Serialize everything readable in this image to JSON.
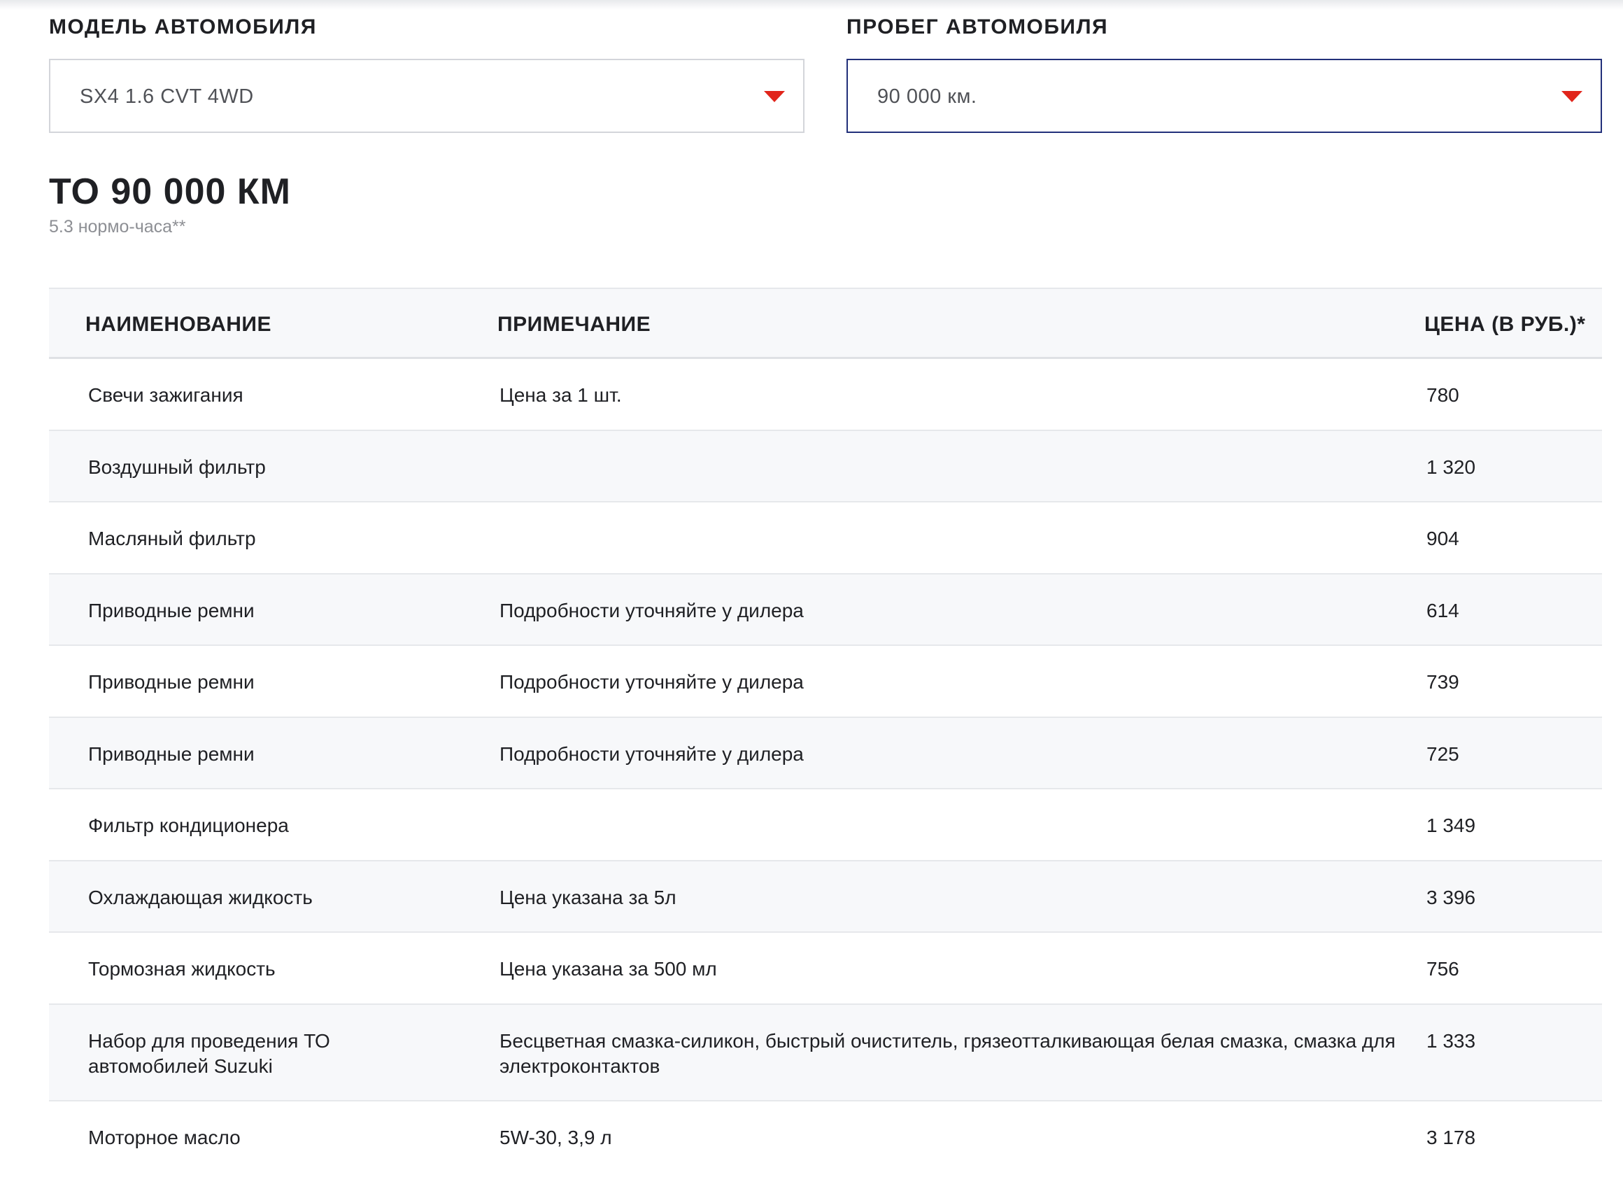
{
  "selectors": {
    "model": {
      "label": "МОДЕЛЬ АВТОМОБИЛЯ",
      "value": "SX4 1.6 CVT 4WD"
    },
    "mileage": {
      "label": "ПРОБЕГ АВТОМОБИЛЯ",
      "value": "90 000 км."
    }
  },
  "service": {
    "title": "ТО 90 000 КМ",
    "hours": "5.3 нормо-часа**"
  },
  "table": {
    "headers": {
      "name": "НАИМЕНОВАНИЕ",
      "note": "ПРИМЕЧАНИЕ",
      "price": "ЦЕНА (В РУБ.)*"
    },
    "rows": [
      {
        "name": "Свечи зажигания",
        "note": "Цена за 1 шт.",
        "price": "780"
      },
      {
        "name": "Воздушный фильтр",
        "note": "",
        "price": "1 320"
      },
      {
        "name": "Масляный фильтр",
        "note": "",
        "price": "904"
      },
      {
        "name": "Приводные ремни",
        "note": "Подробности уточняйте у дилера",
        "price": "614"
      },
      {
        "name": "Приводные ремни",
        "note": "Подробности уточняйте у дилера",
        "price": "739"
      },
      {
        "name": "Приводные ремни",
        "note": "Подробности уточняйте у дилера",
        "price": "725"
      },
      {
        "name": "Фильтр кондиционера",
        "note": "",
        "price": "1 349"
      },
      {
        "name": "Охлаждающая жидкость",
        "note": "Цена указана за 5л",
        "price": "3 396"
      },
      {
        "name": "Тормозная жидкость",
        "note": "Цена указана за 500 мл",
        "price": "756"
      },
      {
        "name": "Набор для проведения ТО автомобилей Suzuki",
        "note": "Бесцветная смазка-силикон, быстрый очиститель, грязеотталкивающая белая смазка, смазка для электроконтактов",
        "price": "1 333"
      },
      {
        "name": "Моторное масло",
        "note": "5W-30, 3,9 л",
        "price": "3 178"
      }
    ]
  },
  "colors": {
    "accent": "#e1251b",
    "focus_border": "#22307a"
  }
}
